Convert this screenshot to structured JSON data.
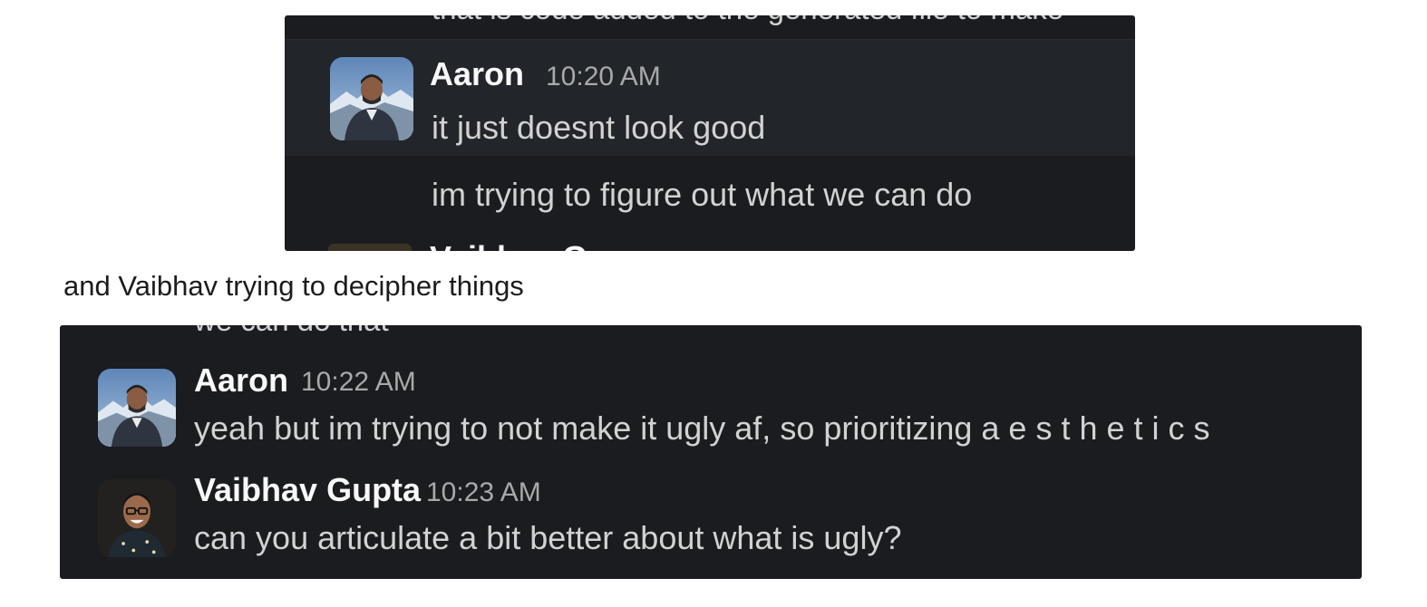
{
  "top_screenshot": {
    "cut_off_text": "that is code added to the generated file to make",
    "messages": [
      {
        "author": "Aaron",
        "time": "10:20 AM",
        "text": "it just doesnt look good",
        "avatar_icon": "aaron-avatar"
      },
      {
        "text": "im trying to figure out what we can do"
      }
    ],
    "cut_off_bottom": "Vaibhav G"
  },
  "caption": "and Vaibhav trying to decipher things",
  "bottom_screenshot": {
    "cut_off_text": "we can do that",
    "messages": [
      {
        "author": "Aaron",
        "time": "10:22 AM",
        "text": "yeah but im trying to not make it ugly af, so prioritizing a e s t h e t i c s",
        "avatar_icon": "aaron-avatar"
      },
      {
        "author": "Vaibhav Gupta",
        "time": "10:23 AM",
        "text": "can you articulate a bit better about what is ugly?",
        "avatar_icon": "vaibhav-avatar"
      }
    ]
  },
  "colors": {
    "background": "#1b1c1f",
    "highlight": "#222529",
    "name": "#f8f8f8",
    "message_text": "#d1d2d3",
    "timestamp": "#a8a9ab"
  }
}
